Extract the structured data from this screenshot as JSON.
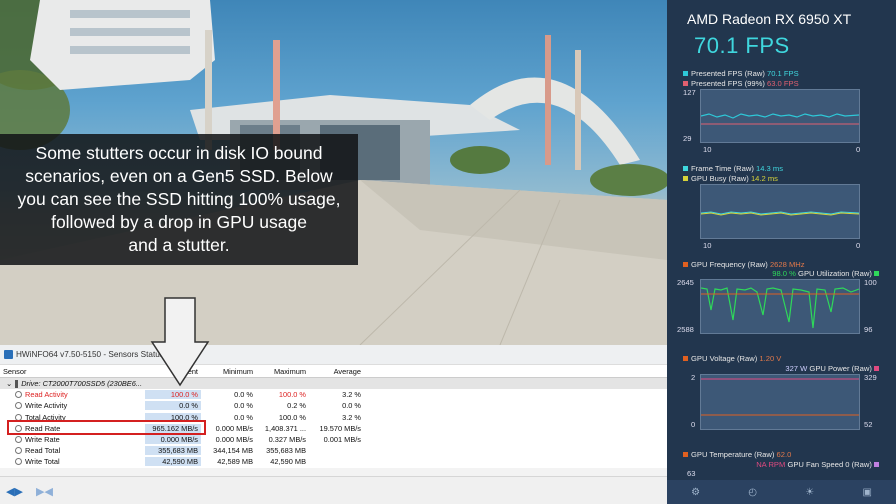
{
  "caption": {
    "line1": "Some stutters occur in disk IO bound",
    "line2": "scenarios, even on a Gen5 SSD. Below",
    "line3": "you can see the SSD hitting 100% usage,",
    "line4": "followed by a drop in GPU usage",
    "line5": "and a stutter."
  },
  "hwinfo": {
    "title": "HWiNFO64 v7.50-5150 - Sensors Status",
    "headers": {
      "sensor": "Sensor",
      "current": "Current",
      "minimum": "Minimum",
      "maximum": "Maximum",
      "average": "Average"
    },
    "drive": "Drive: CT2000T700SSD5 (230BE6...",
    "rows": [
      {
        "name": "Read Activity",
        "current": "100.0 %",
        "minimum": "0.0 %",
        "maximum": "100.0 %",
        "average": "3.2 %"
      },
      {
        "name": "Write Activity",
        "current": "0.0 %",
        "minimum": "0.0 %",
        "maximum": "0.2 %",
        "average": "0.0 %"
      },
      {
        "name": "Total Activity",
        "current": "100.0 %",
        "minimum": "0.0 %",
        "maximum": "100.0 %",
        "average": "3.2 %"
      },
      {
        "name": "Read Rate",
        "current": "965.162 MB/s",
        "minimum": "0.000 MB/s",
        "maximum": "1,408.371 ...",
        "average": "19.570 MB/s"
      },
      {
        "name": "Write Rate",
        "current": "0.000 MB/s",
        "minimum": "0.000 MB/s",
        "maximum": "0.327 MB/s",
        "average": "0.001 MB/s"
      },
      {
        "name": "Read Total",
        "current": "355,683 MB",
        "minimum": "344,154 MB",
        "maximum": "355,683 MB",
        "average": ""
      },
      {
        "name": "Write Total",
        "current": "42,590 MB",
        "minimum": "42,589 MB",
        "maximum": "42,590 MB",
        "average": ""
      }
    ]
  },
  "osd": {
    "gpu_name": "AMD Radeon RX 6950 XT",
    "fps": "70.1 FPS",
    "graphs": {
      "fps": {
        "legend1": "Presented FPS (Raw)",
        "value1": "70.1 FPS",
        "legend2": "Presented FPS (99%)",
        "value2": "63.0 FPS",
        "ytop": "127",
        "ybot": "29",
        "xleft": "10",
        "xright": "0"
      },
      "frametime": {
        "legend1": "Frame Time (Raw)",
        "value1": "14.3 ms",
        "legend2": "GPU Busy (Raw)",
        "value2": "14.2 ms",
        "xleft": "10",
        "xright": "0"
      },
      "freq": {
        "legend1": "GPU Frequency (Raw)",
        "value1": "2628 MHz",
        "legend2_value": "98.0 %",
        "legend2": "GPU Utilization (Raw)",
        "yl_top": "2645",
        "yl_bot": "2588",
        "yr_top": "100",
        "yr_bot": "96"
      },
      "power": {
        "legend1": "GPU Voltage (Raw)",
        "value1": "1.20 V",
        "legend2_value": "327 W",
        "legend2": "GPU Power (Raw)",
        "yl_top": "2",
        "yl_bot": "0",
        "yr_top": "329",
        "yr_bot": "52"
      },
      "temp": {
        "legend1": "GPU Temperature (Raw)",
        "value1": "62.0",
        "legend2_value": "NA RPM",
        "legend2": "GPU Fan Speed 0 (Raw)",
        "ytop": "63"
      }
    },
    "colors": {
      "fps": "#3fd7de",
      "fps_line1": "#2ec8d8",
      "fps_line2": "#e06070",
      "frame": "#3fd7de",
      "busy": "#d6d23a",
      "freq": "#2fd85a",
      "util": "#2fd85a",
      "volt": "#e06020",
      "power": "#e04a80"
    }
  }
}
